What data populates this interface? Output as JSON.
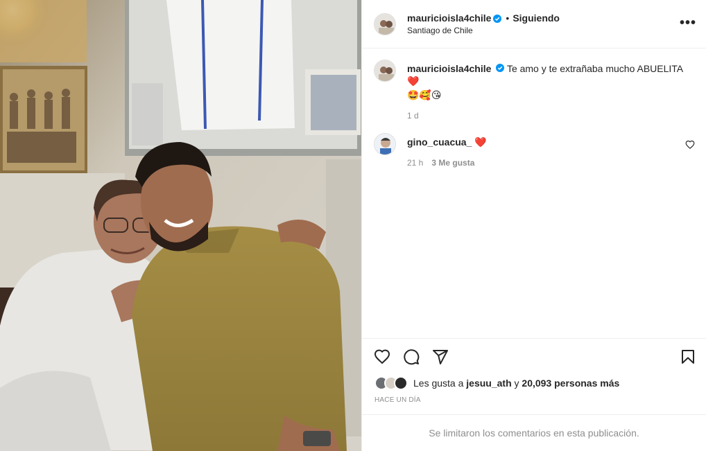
{
  "post": {
    "image_alt": "Photo of a smiling man in an olive t-shirt with his arm around an older woman with glasses"
  },
  "header": {
    "username": "mauricioisla4chile",
    "separator": "•",
    "follow_status": "Siguiendo",
    "location": "Santiago de Chile",
    "more_icon": "more-horizontal-icon",
    "more_label": "•••"
  },
  "caption": {
    "username": "mauricioisla4chile",
    "text": "Te amo y te extrañaba mucho ABUELITA",
    "heart": "❤️",
    "emojis": "🤩🥰😘",
    "time": "1 d"
  },
  "comments": [
    {
      "username": "gino_cuacua_",
      "text": "❤️",
      "time": "21 h",
      "likes": "3 Me gusta"
    }
  ],
  "actions": {
    "like_icon": "heart-outline-icon",
    "comment_icon": "comment-icon",
    "share_icon": "send-icon",
    "save_icon": "bookmark-icon"
  },
  "likes": {
    "prefix": "Les gusta a",
    "user": "jesuu_ath",
    "middle": "y",
    "count": "20,093 personas más"
  },
  "time_ago": "HACE UN DÍA",
  "comments_limited": "Se limitaron los comentarios en esta publicación.",
  "colors": {
    "text": "#262626",
    "secondary": "#8e8e8e",
    "border": "#efefef",
    "verified": "#0095f6",
    "heart": "#ed1f2d"
  }
}
